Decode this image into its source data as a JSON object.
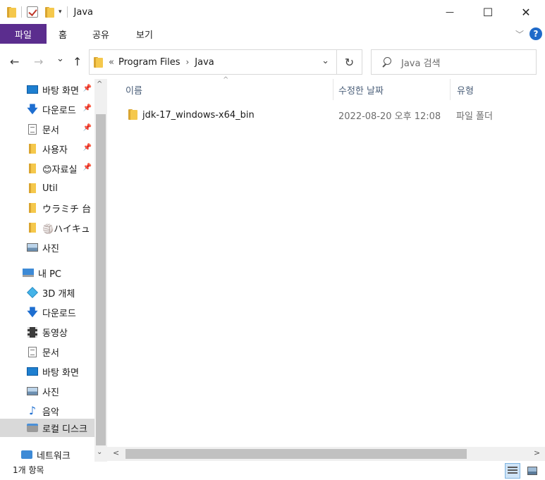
{
  "window": {
    "title": "Java",
    "quick_access_dropdown": "▾",
    "minimize": "—",
    "maximize": "☐",
    "close": "✕"
  },
  "ribbon": {
    "file_tab": "파일",
    "tabs": [
      "홈",
      "공유",
      "보기"
    ],
    "help": "?"
  },
  "address": {
    "back": "←",
    "forward": "→",
    "recent": "⌄",
    "up": "↑",
    "overflow": "«",
    "crumbs": [
      "Program Files",
      "Java"
    ],
    "separator": "›",
    "dropdown": "⌄",
    "refresh": "↻"
  },
  "search": {
    "placeholder": "Java 검색"
  },
  "sidebar": {
    "items": [
      {
        "label": "바탕 화면",
        "icon": "desktop-icon",
        "pinned": true
      },
      {
        "label": "다운로드",
        "icon": "download-icon",
        "pinned": true
      },
      {
        "label": "문서",
        "icon": "documents-icon",
        "pinned": true
      },
      {
        "label": "사용자",
        "icon": "folder-icon",
        "pinned": true
      },
      {
        "label": "😊자료실",
        "icon": "folder-icon",
        "pinned": true
      },
      {
        "label": "Util",
        "icon": "folder-icon",
        "pinned": false
      },
      {
        "label": "ウラミチ 台",
        "icon": "folder-icon",
        "pinned": false
      },
      {
        "label": "🏐ハイキュ",
        "icon": "folder-icon",
        "pinned": false
      },
      {
        "label": "사진",
        "icon": "pictures-icon",
        "pinned": false
      },
      {
        "label": "내 PC",
        "icon": "this-pc-icon",
        "pinned": false
      },
      {
        "label": "3D 개체",
        "icon": "3d-objects-icon",
        "pinned": false
      },
      {
        "label": "다운로드",
        "icon": "download-icon",
        "pinned": false
      },
      {
        "label": "동영상",
        "icon": "video-icon",
        "pinned": false
      },
      {
        "label": "문서",
        "icon": "documents-icon",
        "pinned": false
      },
      {
        "label": "바탕 화면",
        "icon": "desktop-icon",
        "pinned": false
      },
      {
        "label": "사진",
        "icon": "pictures-icon",
        "pinned": false
      },
      {
        "label": "음악",
        "icon": "music-icon",
        "pinned": false
      },
      {
        "label": "로컬 디스크",
        "icon": "local-disk-icon",
        "pinned": false,
        "selected": true
      },
      {
        "label": "네트워크",
        "icon": "network-icon",
        "pinned": false
      }
    ],
    "pin_glyph": "📌",
    "scroll_up": "^",
    "scroll_down": "⌄"
  },
  "columns": {
    "name": "이름",
    "date": "수정한 날짜",
    "type": "유형",
    "sort_indicator": "^"
  },
  "files": [
    {
      "name": "jdk-17_windows-x64_bin",
      "date": "2022-08-20 오후 12:08",
      "type": "파일 폴더"
    }
  ],
  "hscroll": {
    "left": "<",
    "right": ">"
  },
  "status": {
    "count": "1개 항목"
  }
}
